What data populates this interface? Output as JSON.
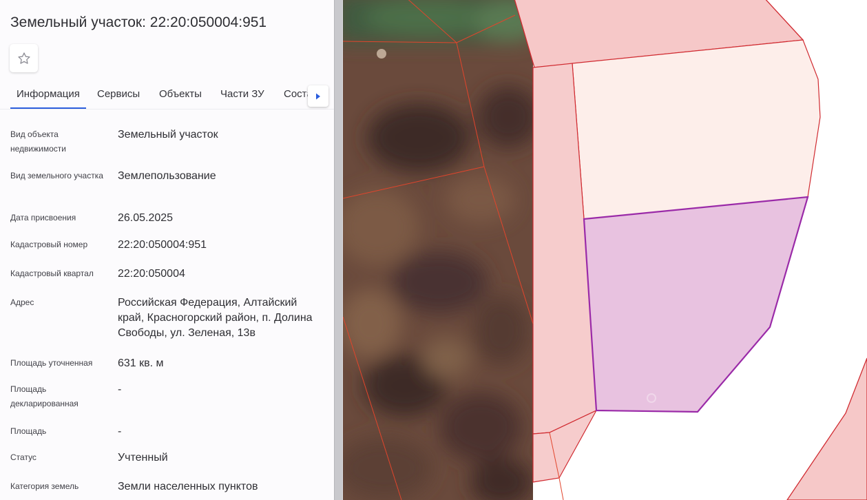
{
  "header": {
    "title": "Земельный участок: 22:20:050004:951"
  },
  "tabs": [
    {
      "label": "Информация"
    },
    {
      "label": "Сервисы"
    },
    {
      "label": "Объекты"
    },
    {
      "label": "Части ЗУ"
    },
    {
      "label": "Состав"
    }
  ],
  "info": [
    {
      "label": "Вид объекта недвижимости",
      "value": "Земельный участок"
    },
    {
      "label": "Вид земельного участка",
      "value": "Землепользование"
    },
    {
      "label": "Дата присвоения",
      "value": "26.05.2025"
    },
    {
      "label": "Кадастровый номер",
      "value": "22:20:050004:951"
    },
    {
      "label": "Кадастровый квартал",
      "value": "22:20:050004"
    },
    {
      "label": "Адрес",
      "value": "Российская Федерация, Алтайский край, Красногорский район, п. Долина Свободы, ул. Зеленая, 13в"
    },
    {
      "label": "Площадь уточненная",
      "value": "631 кв. м"
    },
    {
      "label": "Площадь декларированная",
      "value": "-"
    },
    {
      "label": "Площадь",
      "value": "-"
    },
    {
      "label": "Статус",
      "value": "Учтенный"
    },
    {
      "label": "Категория земель",
      "value": "Земли населенных пунктов"
    }
  ],
  "icons": {
    "favorite": "star-icon",
    "tabs_scroll": "caret-right-icon"
  },
  "colors": {
    "active_tab": "#2a5ddd",
    "parcel_border": "#d02a30",
    "selected_parcel_fill": "#e8c2e0",
    "selected_parcel_border": "#9a2aa8",
    "adjacent_parcel_fill": "#f6c8c8"
  }
}
